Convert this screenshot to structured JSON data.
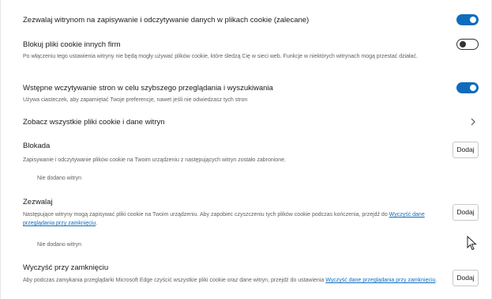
{
  "settings": {
    "allow_cookies": {
      "title": "Zezwalaj witrynom na zapisywanie i odczytywanie danych w plikach cookie (zalecane)",
      "enabled": true
    },
    "block_third_party": {
      "title": "Blokuj pliki cookie innych firm",
      "description": "Po włączeniu tego ustawienia witryny nie będą mogły używać plików cookie, które śledzą Cię w sieci web. Funkcje w niektórych witrynach mogą przestać działać.",
      "enabled": false
    },
    "preload": {
      "title": "Wstępne wczytywanie stron w celu szybszego przeglądania i wyszukiwania",
      "description": "Używa ciasteczek, aby zapamiętać Twoje preferencje, nawet jeśli nie odwiedzasz tych stron",
      "enabled": true
    },
    "see_all": {
      "title": "Zobacz wszystkie pliki cookie i dane witryn"
    },
    "block": {
      "title": "Blokada",
      "description": "Zapisywanie i odczytywanie plików cookie na Twoim urządzeniu z następujących witryn zostało zabronione.",
      "button": "Dodaj",
      "empty": "Nie dodano witryn"
    },
    "allow": {
      "title": "Zezwalaj",
      "description_before": "Następujące witryny mogą zapisywać pliki cookie na Twoim urządzeniu. Aby zapobiec czyszczeniu tych plików cookie podczas kończenia, przejdź do ",
      "link": "Wyczyść dane przeglądania przy zamknięciu",
      "description_after": ".",
      "button": "Dodaj",
      "empty": "Nie dodano witryn"
    },
    "clear_on_close": {
      "title": "Wyczyść przy zamknięciu",
      "description_before": "Aby podczas zamykania przeglądarki Microsoft Edge czyścić wszystkie pliki cookie oraz dane witryn, przejdź do ustawienia ",
      "link": "Wyczyść dane przeglądania przy zamknięciu",
      "description_after": ".",
      "button": "Dodaj"
    }
  },
  "colors": {
    "accent": "#0f6cbd",
    "text": "#1b1b1b",
    "secondary_text": "#5f5f5f"
  },
  "icons": {
    "chevron": "chevron-right-icon",
    "cursor": "mouse-pointer-icon"
  }
}
